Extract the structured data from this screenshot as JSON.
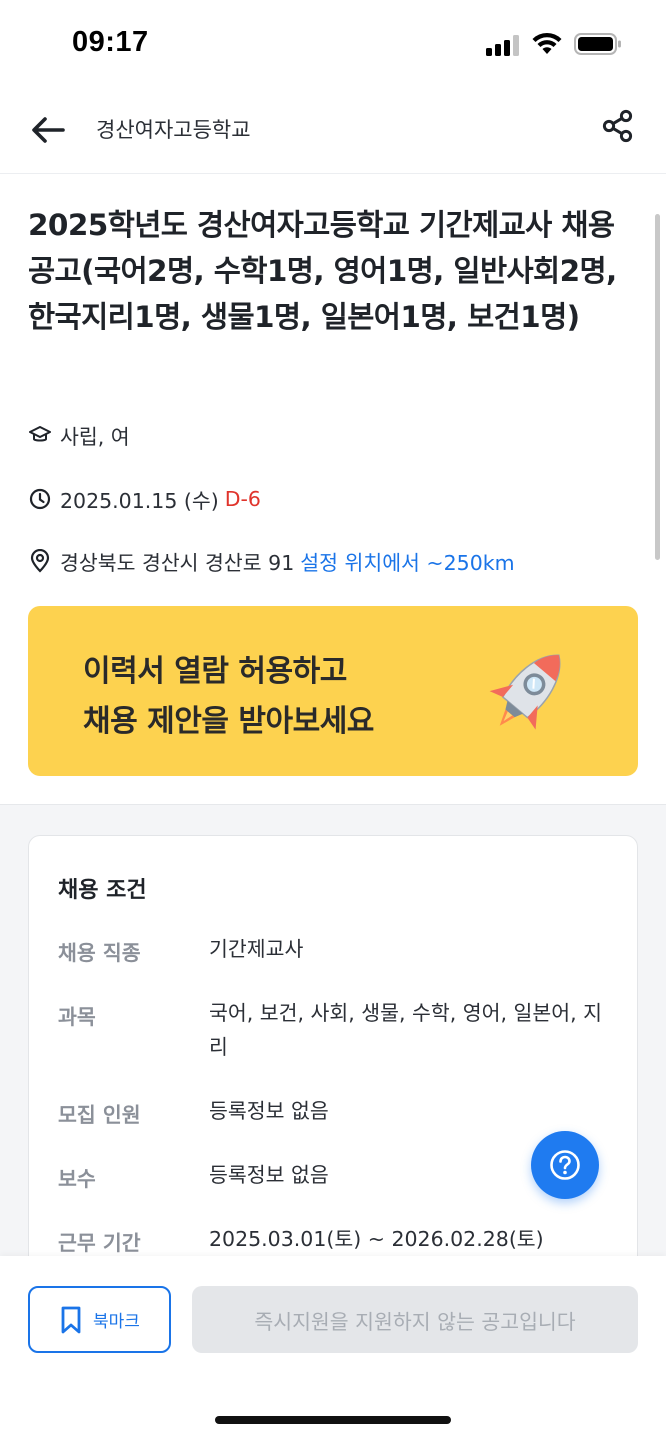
{
  "status_bar": {
    "time": "09:17"
  },
  "header": {
    "title": "경산여자고등학교",
    "back_icon": "arrow-left-icon",
    "share_icon": "share-icon"
  },
  "job": {
    "title": "2025학년도 경산여자고등학교 기간제교사 채용 공고(국어2명, 수학1명, 영어1명, 일반사회2명, 한국지리1명, 생물1명, 일본어1명, 보건1명)",
    "school_type": "사립, 여",
    "deadline_date": "2025.01.15 (수)",
    "dday": "D-6",
    "address": "경상북도 경산시 경산로 91",
    "distance": "설정 위치에서 ~250km"
  },
  "banner": {
    "line1": "이력서 열람 허용하고",
    "line2": "채용 제안을 받아보세요"
  },
  "conditions": {
    "title": "채용 조건",
    "rows": [
      {
        "label": "채용 직종",
        "value": "기간제교사"
      },
      {
        "label": "과목",
        "value": "국어, 보건, 사회, 생물, 수학, 영어, 일본어, 지리"
      },
      {
        "label": "모집 인원",
        "value": "등록정보 없음"
      },
      {
        "label": "보수",
        "value": "등록정보 없음"
      },
      {
        "label": "근무 기간",
        "value": "2025.03.01(토) ~ 2026.02.28(토)"
      }
    ]
  },
  "bottom": {
    "bookmark_label": "북마크",
    "apply_label": "즉시지원을 지원하지 않는 공고입니다"
  },
  "colors": {
    "accent": "#1a74e8",
    "dday": "#e0342c",
    "banner": "#fdd24f",
    "fab": "#1f7bf0"
  }
}
